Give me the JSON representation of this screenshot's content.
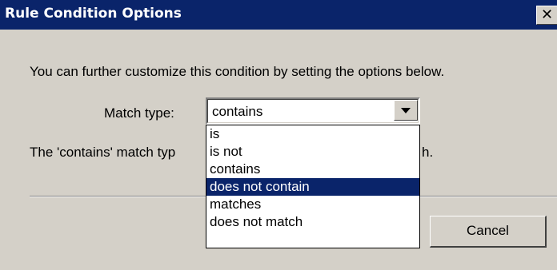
{
  "dialog": {
    "title": "Rule Condition Options",
    "close_label": "✕",
    "intro_text": "You can further customize this condition by setting the options below.",
    "match_type_label": "Match type:",
    "match_type_value": "contains",
    "description_left": "The 'contains' match typ",
    "description_right": "h.",
    "cancel_label": "Cancel"
  },
  "dropdown": {
    "options": [
      {
        "label": "is",
        "selected": false
      },
      {
        "label": "is not",
        "selected": false
      },
      {
        "label": "contains",
        "selected": false
      },
      {
        "label": "does not contain",
        "selected": true
      },
      {
        "label": "matches",
        "selected": false
      },
      {
        "label": "does not match",
        "selected": false
      }
    ]
  },
  "colors": {
    "titlebar": "#0a246a",
    "face": "#d4d0c8",
    "selection": "#0a246a"
  },
  "icons": {
    "close": "close-icon",
    "dropdown": "chevron-down-icon"
  }
}
